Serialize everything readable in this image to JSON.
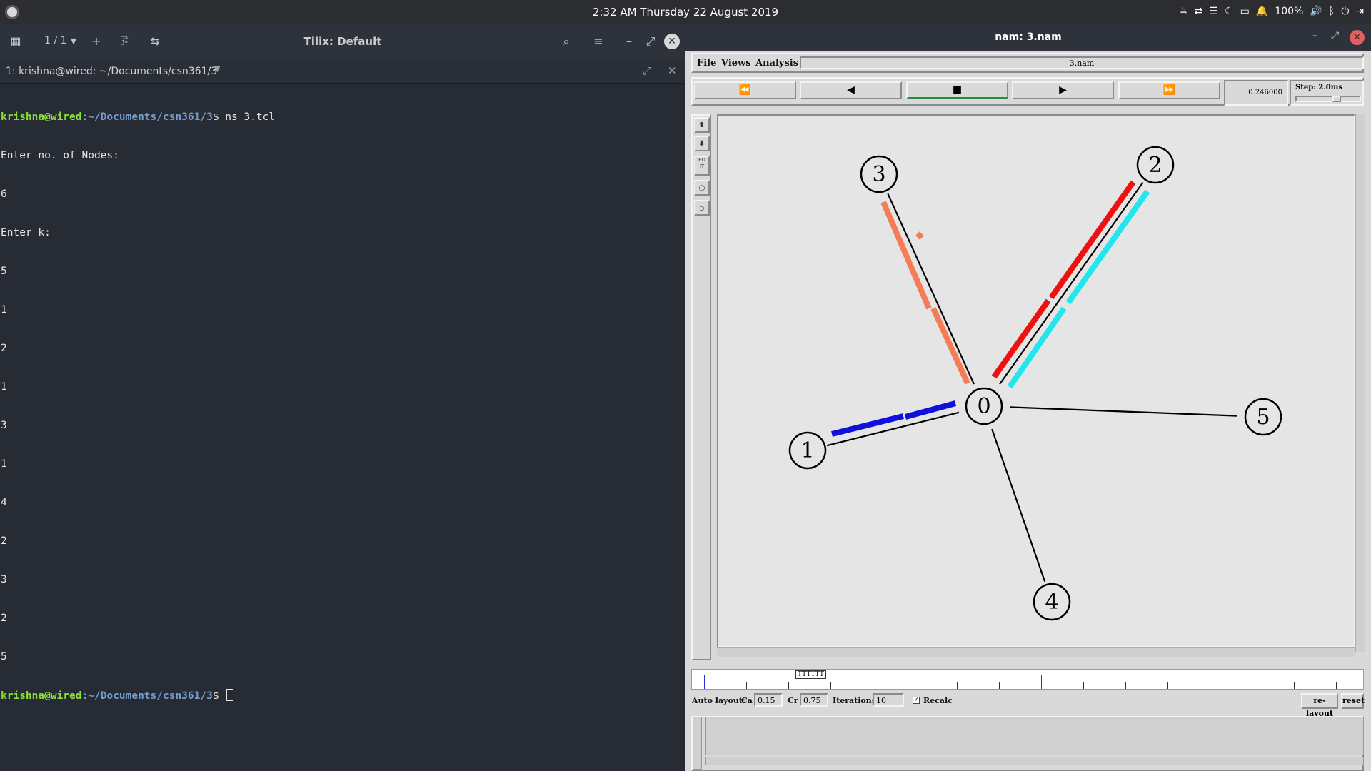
{
  "topbar": {
    "clock": "2:32 AM  Thursday 22 August 2019",
    "battery": "100%",
    "tray_icons": [
      "coffee-icon",
      "network-icon",
      "menu-icon",
      "moon-icon",
      "folder-icon",
      "notification-icon",
      "volume-icon",
      "bluetooth-icon",
      "power-icon",
      "logout-icon"
    ]
  },
  "tilix": {
    "title": "Tilix: Default",
    "session_count": "1 / 1",
    "tab_label": "1: krishna@wired: ~/Documents/csn361/3",
    "terminal": {
      "prompt_user": "krishna@wired",
      "prompt_path": ":~/Documents/csn361/3",
      "prompt_symbol": "$",
      "command": " ns 3.tcl",
      "output_lines": [
        "Enter no. of Nodes:",
        "6",
        "Enter k:",
        "5",
        "1",
        "2",
        "1",
        "3",
        "1",
        "4",
        "2",
        "3",
        "2",
        "5"
      ],
      "final_prompt_user": "krishna@wired",
      "final_prompt_path": ":~/Documents/csn361/3",
      "final_prompt_symbol": "$"
    }
  },
  "nam": {
    "window_title": "nam: 3.nam",
    "menu": [
      "File",
      "Views",
      "Analysis"
    ],
    "filename": "3.nam",
    "controls": {
      "rewind": "⏪",
      "back": "◀",
      "stop": "■",
      "play": "▶",
      "fast_forward": "⏩"
    },
    "time": "0.246000",
    "step": "Step: 2.0ms",
    "sidebar_buttons": [
      "zoom-in-icon",
      "zoom-out-icon",
      "edit-icon",
      "node-circle-icon",
      "small-circle-icon"
    ],
    "edit_label": "ED IT",
    "timeline_label": "TTTTTT",
    "autolayout": {
      "label": "Auto layout:",
      "ca_label": "Ca",
      "ca_value": "0.15",
      "cr_label": "Cr",
      "cr_value": "0.75",
      "iterations_label": "Iterations",
      "iterations_value": "10",
      "recalc_label": "Recalc",
      "relayout_button": "re-layout",
      "reset_button": "reset"
    },
    "nodes": [
      {
        "id": "0",
        "label": "0"
      },
      {
        "id": "1",
        "label": "1"
      },
      {
        "id": "2",
        "label": "2"
      },
      {
        "id": "3",
        "label": "3"
      },
      {
        "id": "4",
        "label": "4"
      },
      {
        "id": "5",
        "label": "5"
      }
    ],
    "links": [
      [
        "0",
        "1"
      ],
      [
        "0",
        "2"
      ],
      [
        "0",
        "3"
      ],
      [
        "0",
        "4"
      ],
      [
        "0",
        "5"
      ]
    ],
    "flow_colors": {
      "link_0_3": "#f47c56",
      "link_0_2_a": "#ee1111",
      "link_0_2_b": "#22e6ee",
      "link_0_1": "#1010dd"
    }
  }
}
